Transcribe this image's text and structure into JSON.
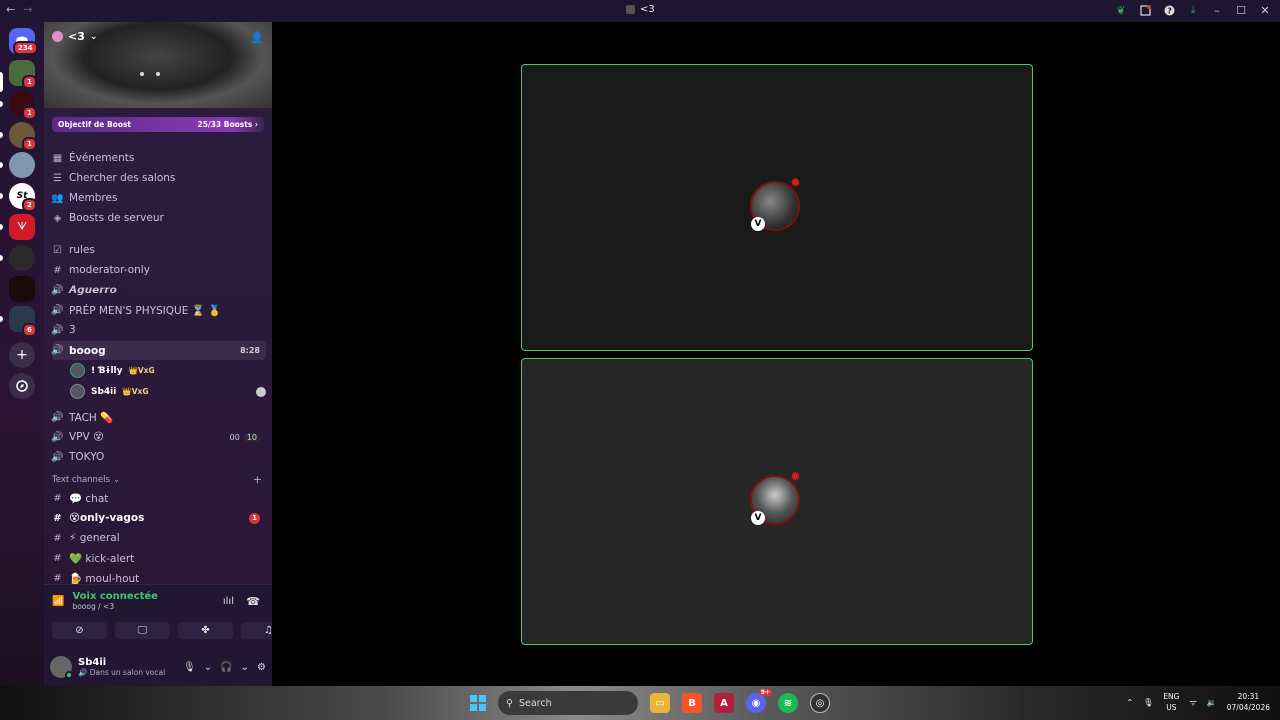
{
  "titlebar": {
    "title": "<3",
    "back": "←",
    "forward": "→"
  },
  "servers": {
    "home_badge": "234",
    "badges": [
      "1",
      "1",
      "1",
      "2",
      "6"
    ]
  },
  "server": {
    "name": "<3",
    "boost_goal_label": "Objectif de Boost",
    "boost_count": "25/33 Boosts"
  },
  "menu": [
    {
      "label": "Événements",
      "icon": "calendar-icon"
    },
    {
      "label": "Chercher des salons",
      "icon": "channel-search-icon"
    },
    {
      "label": "Membres",
      "icon": "members-icon"
    },
    {
      "label": "Boosts de serveur",
      "icon": "boost-icon"
    }
  ],
  "channels": [
    {
      "name": "rules",
      "icon": "rules-icon"
    },
    {
      "name": "moderator-only",
      "icon": "hash-icon"
    },
    {
      "name": "𝘼𝙜𝙪𝙚𝙧𝙧𝙤",
      "icon": "voice-icon"
    },
    {
      "name": "PRÉP MEN'S PHYSIQUE ⌛ 🥇",
      "icon": "voice-icon"
    },
    {
      "name": "3",
      "icon": "voice-icon"
    },
    {
      "name": "booog",
      "icon": "voice-icon",
      "time": "8:28"
    },
    {
      "name": "TACH 💊",
      "icon": "voice-icon"
    },
    {
      "name": "VPV 😵",
      "icon": "voice-icon",
      "count_a": "00",
      "count_b": "10"
    },
    {
      "name": "TOKYO",
      "icon": "voice-icon"
    }
  ],
  "voice_users": [
    {
      "name": "! Ɓɨlly",
      "tag": "👑VxG"
    },
    {
      "name": "Sb4ii",
      "tag": "👑VxG"
    }
  ],
  "text_category": "Text channels",
  "text_channels": [
    {
      "name": "💬 chat"
    },
    {
      "name": "😵only-vagos",
      "badge": "1"
    },
    {
      "name": "⚡ general"
    },
    {
      "name": "💚 kick-alert"
    },
    {
      "name": "🍺 moul-hout"
    }
  ],
  "voice_connection": {
    "status": "Voix connectée",
    "location": "booog / <3"
  },
  "user": {
    "name": "Sb4ii",
    "status": "Dans un salon vocal"
  },
  "taskbar": {
    "search_placeholder": "Search",
    "lang_top": "ENG",
    "lang_bottom": "US",
    "time": "20:31",
    "date": "07/04/2026",
    "discord_badge": "9+"
  }
}
